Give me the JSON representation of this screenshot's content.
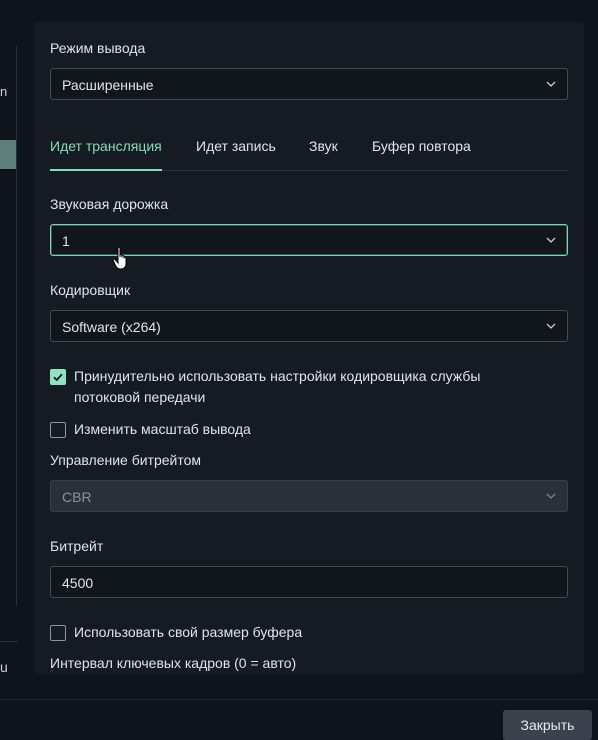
{
  "left_fragments": {
    "top": "n",
    "bottom": "u"
  },
  "output_mode": {
    "label": "Режим вывода",
    "value": "Расширенные"
  },
  "tabs": [
    {
      "label": "Идет трансляция",
      "active": true
    },
    {
      "label": "Идет запись",
      "active": false
    },
    {
      "label": "Звук",
      "active": false
    },
    {
      "label": "Буфер повтора",
      "active": false
    }
  ],
  "audio_track": {
    "label": "Звуковая дорожка",
    "value": "1"
  },
  "encoder": {
    "label": "Кодировщик",
    "value": "Software (x264)"
  },
  "enforce_settings": {
    "line1": "Принудительно использовать настройки кодировщика службы",
    "line2": "потоковой передачи",
    "checked": true
  },
  "rescale_output": {
    "label": "Изменить масштаб вывода",
    "checked": false
  },
  "rate_control": {
    "label": "Управление битрейтом",
    "value": "CBR"
  },
  "bitrate": {
    "label": "Битрейт",
    "value": "4500"
  },
  "custom_buffer": {
    "label": "Использовать свой размер буфера",
    "checked": false
  },
  "keyframe_interval": {
    "label": "Интервал ключевых кадров (0 = авто)"
  },
  "footer": {
    "close_label": "Закрыть"
  },
  "colors": {
    "accent": "#7fe0b8",
    "background": "#0f141c",
    "panel": "#161b23"
  },
  "icons": {
    "dropdown": "chevron-down-icon",
    "cursor": "hand-pointer-icon",
    "check": "checkmark-icon"
  }
}
